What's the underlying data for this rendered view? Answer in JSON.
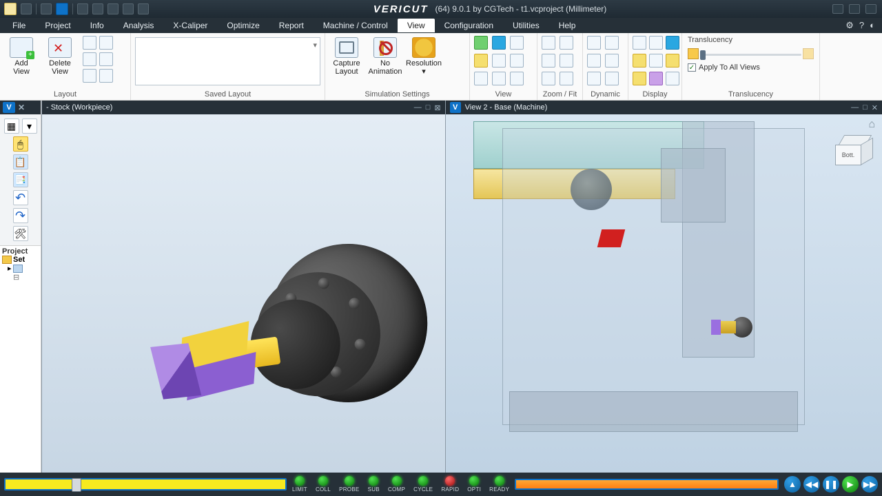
{
  "title": {
    "brand": "VERICUT",
    "info": "(64)  9.0.1 by CGTech - t1.vcproject (Millimeter)"
  },
  "menu": {
    "items": [
      "File",
      "Project",
      "Info",
      "Analysis",
      "X-Caliper",
      "Optimize",
      "Report",
      "Machine / Control",
      "View",
      "Configuration",
      "Utilities",
      "Help"
    ],
    "active": "View"
  },
  "ribbon": {
    "layout": {
      "add": "Add\nView",
      "delete": "Delete\nView",
      "label": "Layout"
    },
    "saved": {
      "label": "Saved Layout"
    },
    "sim": {
      "capture": "Capture\nLayout",
      "noanim": "No\nAnimation",
      "res": "Resolution",
      "label": "Simulation Settings"
    },
    "view": {
      "label": "View"
    },
    "zoom": {
      "label": "Zoom / Fit"
    },
    "dynamic": {
      "label": "Dynamic"
    },
    "display": {
      "label": "Display"
    },
    "trans": {
      "title": "Translucency",
      "apply": "Apply To All Views",
      "label": "Translucency"
    }
  },
  "views": {
    "left": {
      "title": "- Stock (Workpiece)"
    },
    "right": {
      "title": "View 2 - Base (Machine)",
      "cube": "Bott."
    }
  },
  "project_panel": {
    "header": "Project",
    "setup": "Set"
  },
  "status": {
    "lights": [
      "LIMIT",
      "COLL",
      "PROBE",
      "SUB",
      "COMP",
      "CYCLE",
      "RAPID",
      "OPTI",
      "READY"
    ],
    "red_index": 6
  }
}
